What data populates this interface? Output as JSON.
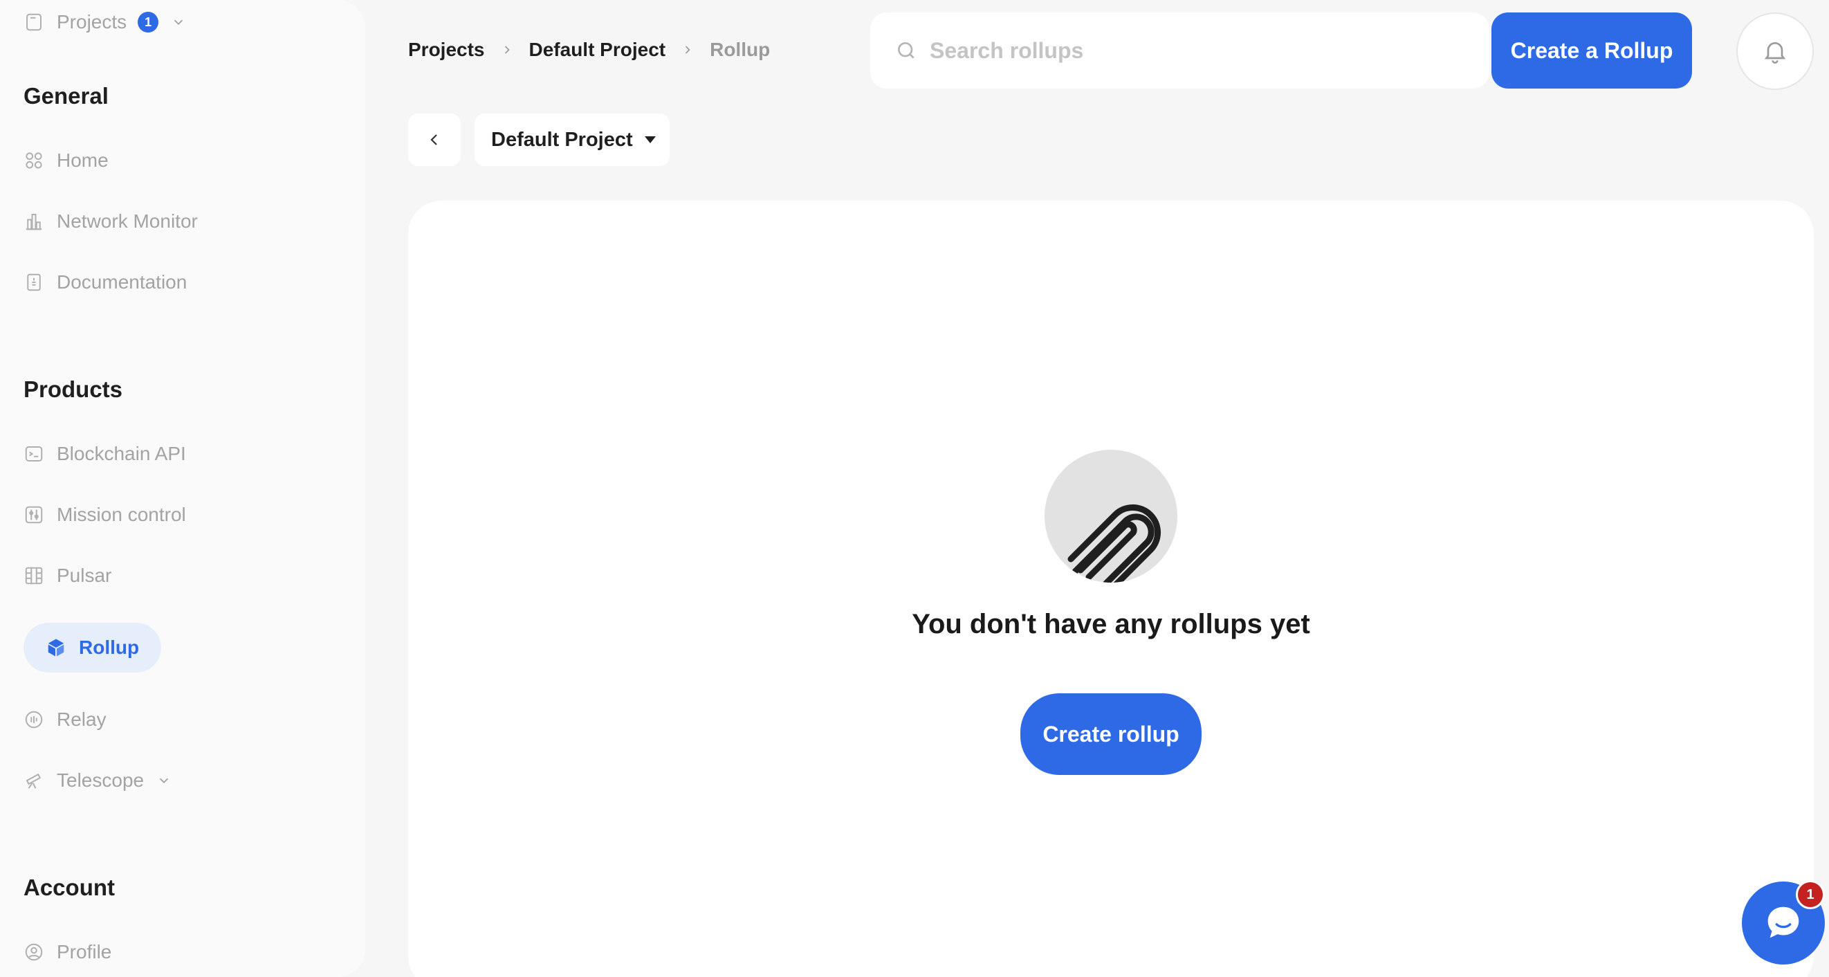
{
  "sidebar": {
    "projects": {
      "label": "Projects",
      "badge": "1",
      "icon": "folder-icon"
    },
    "sections": {
      "general": "General",
      "products": "Products",
      "account": "Account"
    },
    "general_items": [
      {
        "label": "Home",
        "icon": "grid-icon"
      },
      {
        "label": "Network Monitor",
        "icon": "bar-chart-icon"
      },
      {
        "label": "Documentation",
        "icon": "document-icon"
      }
    ],
    "product_items": [
      {
        "label": "Blockchain API",
        "icon": "terminal-icon"
      },
      {
        "label": "Mission control",
        "icon": "sliders-icon"
      },
      {
        "label": "Pulsar",
        "icon": "layout-icon"
      },
      {
        "label": "Rollup",
        "icon": "cube-icon",
        "active": true
      },
      {
        "label": "Relay",
        "icon": "relay-icon"
      },
      {
        "label": "Telescope",
        "icon": "telescope-icon"
      }
    ],
    "account_items": [
      {
        "label": "Profile",
        "icon": "user-icon"
      }
    ]
  },
  "header": {
    "breadcrumb": [
      "Projects",
      "Default Project",
      "Rollup"
    ],
    "search_placeholder": "Search rollups",
    "create_button": "Create a Rollup"
  },
  "subheader": {
    "project_select": "Default Project"
  },
  "main": {
    "empty_message": "You don't have any rollups yet",
    "create_button": "Create rollup"
  },
  "chat": {
    "badge": "1"
  },
  "colors": {
    "accent": "#2f6ae6",
    "active_bg": "#e6eefc",
    "badge_red": "#c42121"
  }
}
